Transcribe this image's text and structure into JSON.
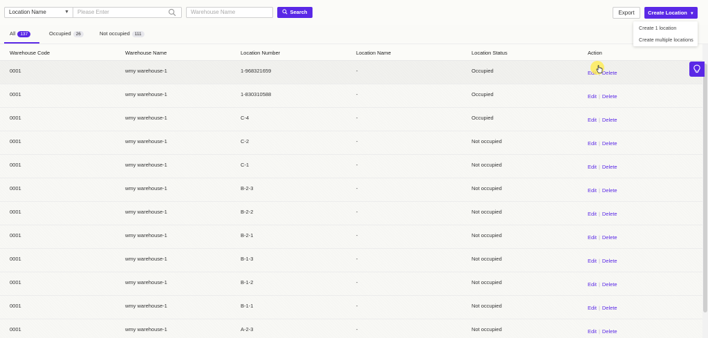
{
  "filter": {
    "field_select": "Location Name",
    "search_placeholder": "Please Enter",
    "warehouse_placeholder": "Warehouse Name",
    "search_label": "Search"
  },
  "actions": {
    "export_label": "Export",
    "create_label": "Create Location",
    "create_menu": [
      "Create 1 location",
      "Create multiple locations"
    ]
  },
  "tabs": [
    {
      "label": "All",
      "count": "137"
    },
    {
      "label": "Occupied",
      "count": "26"
    },
    {
      "label": "Not occupied",
      "count": "111"
    }
  ],
  "table": {
    "headers": [
      "Warehouse Code",
      "Warehouse Name",
      "Location Number",
      "Location Name",
      "Location Status",
      "Action"
    ],
    "rows": [
      [
        "0001",
        "wmy warehouse-1",
        "1-968321659",
        "-",
        "Occupied"
      ],
      [
        "0001",
        "wmy warehouse-1",
        "1-830310588",
        "-",
        "Occupied"
      ],
      [
        "0001",
        "wmy warehouse-1",
        "C-4",
        "-",
        "Occupied"
      ],
      [
        "0001",
        "wmy warehouse-1",
        "C-2",
        "-",
        "Not occupied"
      ],
      [
        "0001",
        "wmy warehouse-1",
        "C-1",
        "-",
        "Not occupied"
      ],
      [
        "0001",
        "wmy warehouse-1",
        "B-2-3",
        "-",
        "Not occupied"
      ],
      [
        "0001",
        "wmy warehouse-1",
        "B-2-2",
        "-",
        "Not occupied"
      ],
      [
        "0001",
        "wmy warehouse-1",
        "B-2-1",
        "-",
        "Not occupied"
      ],
      [
        "0001",
        "wmy warehouse-1",
        "B-1-3",
        "-",
        "Not occupied"
      ],
      [
        "0001",
        "wmy warehouse-1",
        "B-1-2",
        "-",
        "Not occupied"
      ],
      [
        "0001",
        "wmy warehouse-1",
        "B-1-1",
        "-",
        "Not occupied"
      ],
      [
        "0001",
        "wmy warehouse-1",
        "A-2-3",
        "-",
        "Not occupied"
      ]
    ],
    "edit_label": "Edit",
    "delete_label": "Delete",
    "separator": "|"
  },
  "colors": {
    "accent": "#5a28e6"
  },
  "icons": {
    "search": "search-icon",
    "caret": "chevron-down-icon",
    "assistant": "lightbulb-icon"
  }
}
